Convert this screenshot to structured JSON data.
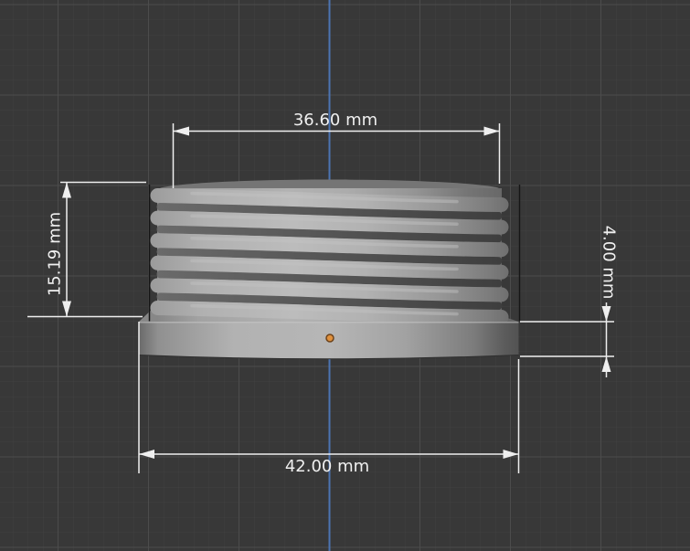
{
  "viewport": {
    "type": "cad-3d-viewport-front-view",
    "part": {
      "name": "threaded-cap",
      "thread_turns": 6,
      "color": "#a8a8a8"
    },
    "dimensions": {
      "thread_outer_diameter": {
        "label": "36.60 mm"
      },
      "total_height": {
        "label": "15.19 mm"
      },
      "flange_thickness": {
        "label": "4.00 mm"
      },
      "flange_diameter": {
        "label": "42.00 mm"
      }
    },
    "colors": {
      "background": "#383838",
      "grid_minor": "#414141",
      "grid_major": "#4c4c4c",
      "axis_blue": "#4c74b2",
      "dimension_white": "#efefef",
      "edge_black": "#161616",
      "origin_orange": "#e0913e"
    }
  }
}
